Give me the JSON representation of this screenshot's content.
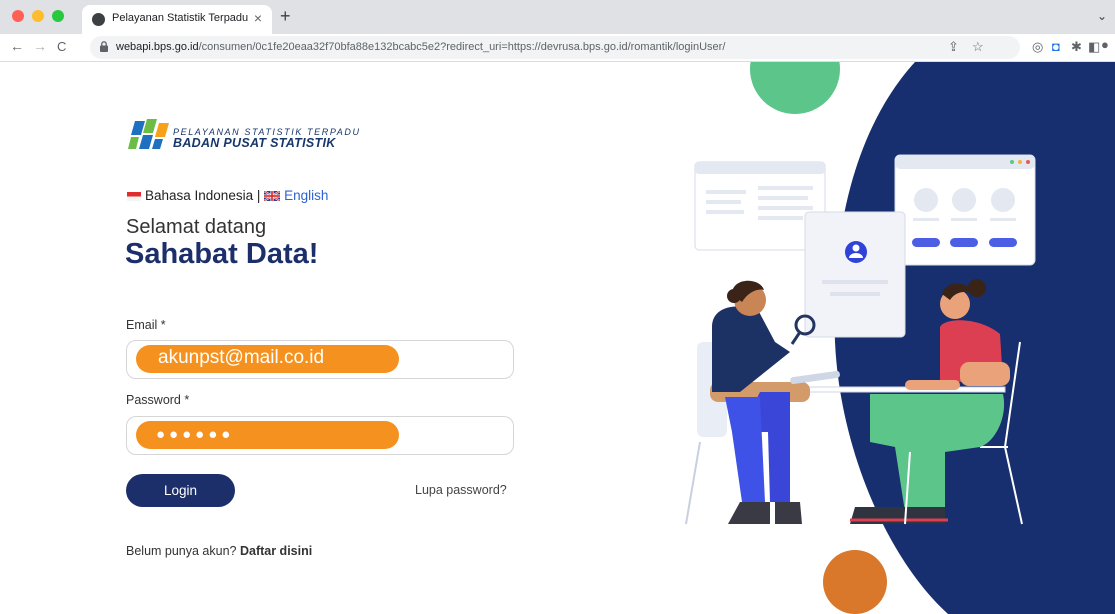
{
  "browser": {
    "tab_title": "Pelayanan Statistik Terpadu",
    "tab_close": "×",
    "new_tab": "+",
    "tab_menu": "⌄",
    "url_host": "webapi.bps.go.id",
    "url_rest": "/consumen/0c1fe20eaa32f70bfa88e132bcabc5e2?redirect_uri=https://devrusa.bps.go.id/romantik/loginUser/",
    "traffic_colors": [
      "#ff5f57",
      "#febc2e",
      "#28c840"
    ]
  },
  "logo": {
    "line1": "PELAYANAN STATISTIK TERPADU",
    "line2": "BADAN PUSAT STATISTIK"
  },
  "language": {
    "indonesian": "Bahasa Indonesia",
    "separator": " | ",
    "english": "English"
  },
  "welcome": "Selamat datang",
  "headline": "Sahabat Data!",
  "form": {
    "email_label": "Email *",
    "email_value": "akunpst@mail.co.id",
    "password_label": "Password *",
    "password_value": "●●●●●●",
    "login_label": "Login",
    "forgot_label": "Lupa password?",
    "signup_prompt": "Belum punya akun? ",
    "signup_link": "Daftar disini"
  },
  "colors": {
    "brand_navy": "#1c2f6b",
    "highlight_orange": "#f5921f",
    "link_blue": "#2d62d6",
    "illustration_navy": "#172f6e",
    "illustration_green": "#5cc58a",
    "illustration_orange": "#d9772b"
  }
}
